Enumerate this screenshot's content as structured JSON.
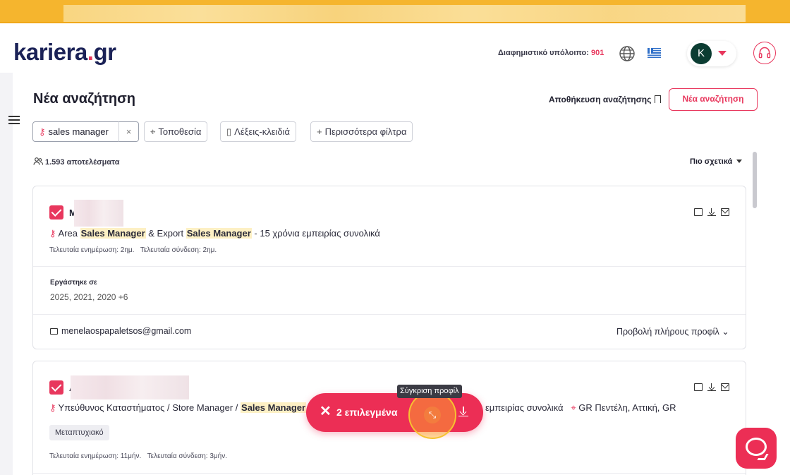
{
  "header": {
    "logo_main": "kariera",
    "logo_dot": ".",
    "logo_tld": "gr",
    "credit_label": "Διαφημιστικό υπόλοιπο:",
    "credit_value": "901",
    "avatar_letter": "K"
  },
  "page": {
    "title": "Νέα αναζήτηση",
    "save_search_label": "Αποθήκευση αναζήτησης",
    "new_search_button": "Νέα αναζήτηση"
  },
  "filters": {
    "keyword_chip": "sales manager",
    "clear_symbol": "×",
    "location_chip": "Τοποθεσία",
    "keywords_chip": "Λέξεις-κλειδιά",
    "more_filters_chip": "Περισσότερα φίλτρα"
  },
  "results": {
    "count_label": "1.593 αποτελέσματα",
    "sort_label": "Πιο σχετικά"
  },
  "candidates": [
    {
      "initial": "M",
      "headline_prefix": "Area ",
      "headline_hl1": "Sales Manager",
      "headline_mid": " & Export ",
      "headline_hl2": "Sales Manager",
      "headline_suffix": " - 15 χρόνια εμπειρίας συνολικά",
      "last_update": "Τελευταία ενημέρωση: 2ημ.",
      "last_login": "Τελευταία σύνδεση: 2ημ.",
      "worked_label": "Εργάστηκε σε",
      "worked_years": "2025, 2021, 2020 +6",
      "email": "menelaospapaletsos@gmail.com",
      "view_profile": "Προβολή πλήρους προφίλ"
    },
    {
      "initial": "A",
      "headline_prefix": "Υπεύθυνος Καταστήματος / Store Manager / ",
      "headline_hl1": "Sales Manager",
      "headline_suffix_visible": " /",
      "headline_tail": "εμπειρίας συνολικά",
      "location": "GR Πεντέλη, Αττική, GR",
      "tag": "Μεταπτυχιακό",
      "last_update": "Τελευταία ενημέρωση: 11μήν.",
      "last_login": "Τελευταία σύνδεση: 3μήν."
    }
  ],
  "action_bar": {
    "close_symbol": "✕",
    "selected_label": "2 επιλεγμένα",
    "compare_tooltip": "Σύγκριση προφίλ"
  },
  "colors": {
    "brand_navy": "#1b2257",
    "accent_red": "#e8375d",
    "banner_yellow": "#f5b52e"
  },
  "icons": [
    "globe-icon",
    "greek-flag-icon",
    "headset-icon",
    "menu-icon",
    "bookmark-icon",
    "key-icon",
    "location-pin-icon",
    "document-icon",
    "plus-icon",
    "users-icon",
    "folder-icon",
    "download-icon",
    "mail-icon",
    "compare-icon",
    "chat-icon"
  ]
}
